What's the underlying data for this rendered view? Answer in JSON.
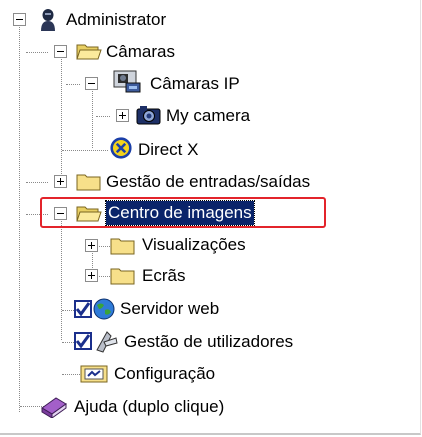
{
  "tree": {
    "items": [
      {
        "label": "Administrator"
      },
      {
        "label": "Câmaras"
      },
      {
        "label": "Câmaras IP"
      },
      {
        "label": "My camera"
      },
      {
        "label": "Direct X"
      },
      {
        "label": "Gestão de entradas/saídas"
      },
      {
        "label": "Centro de imagens",
        "selected": true
      },
      {
        "label": "Visualizações"
      },
      {
        "label": "Ecrãs"
      },
      {
        "label": "Servidor web",
        "checked": true
      },
      {
        "label": "Gestão de utilizadores",
        "checked": true
      },
      {
        "label": "Configuração"
      },
      {
        "label": "Ajuda (duplo clique)"
      }
    ]
  },
  "colors": {
    "selection": "#0a246a",
    "highlight_box": "#e3242b",
    "folder": "#f7e08a"
  },
  "icons": {
    "administrator": "user-icon",
    "cameras": "folder-open-icon",
    "ip_cameras": "ip-camera-icon",
    "my_camera": "camera-icon",
    "direct_x": "directx-icon",
    "io": "folder-icon",
    "image_center": "folder-open-icon",
    "views": "folder-icon",
    "screens": "folder-icon",
    "web_server": "globe-icon",
    "users": "users-tool-icon",
    "config": "configuration-icon",
    "help": "help-book-icon"
  }
}
